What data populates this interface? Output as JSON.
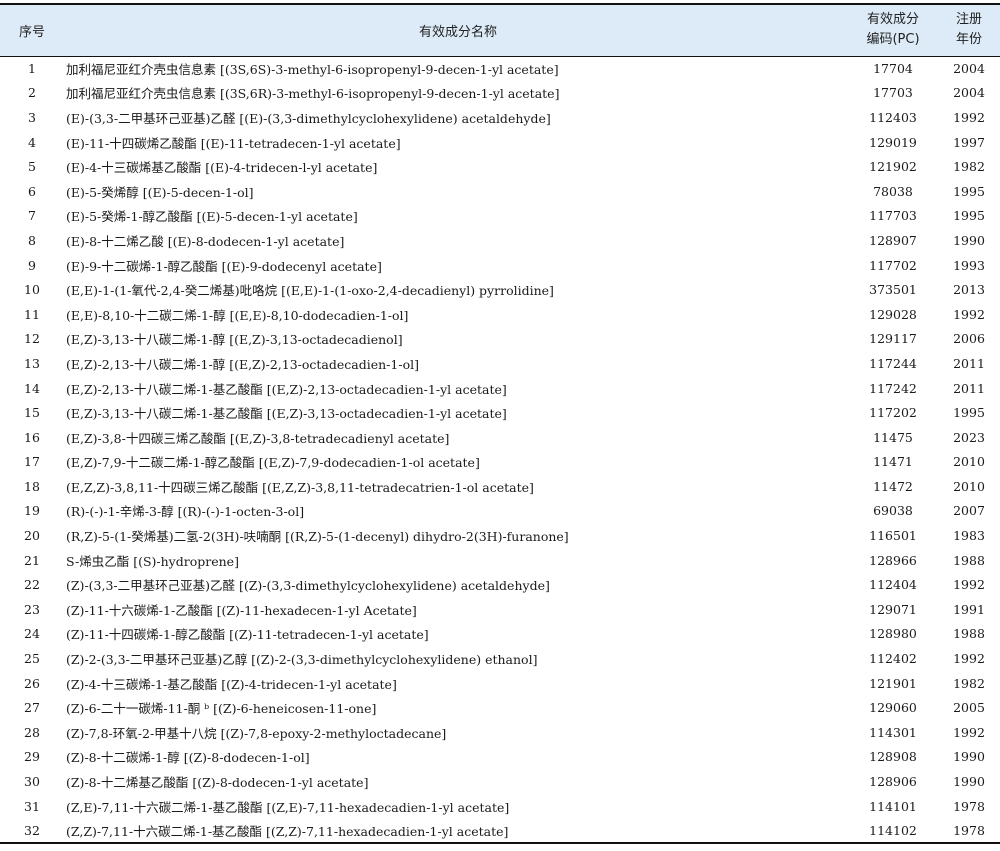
{
  "header": {
    "no": "序号",
    "name": "有效成分名称",
    "code_line1": "有效成分",
    "code_line2": "编码(PC)",
    "year_line1": "注册",
    "year_line2": "年份"
  },
  "rows": [
    {
      "no": "1",
      "name": "加利福尼亚红介壳虫信息素 [(3S,6S)-3-methyl-6-isopropenyl-9-decen-1-yl acetate]",
      "code": "17704",
      "year": "2004"
    },
    {
      "no": "2",
      "name": "加利福尼亚红介壳虫信息素 [(3S,6R)-3-methyl-6-isopropenyl-9-decen-1-yl acetate]",
      "code": "17703",
      "year": "2004"
    },
    {
      "no": "3",
      "name": "(E)-(3,3-二甲基环己亚基)乙醛 [(E)-(3,3-dimethylcyclohexylidene) acetaldehyde]",
      "code": "112403",
      "year": "1992"
    },
    {
      "no": "4",
      "name": "(E)-11-十四碳烯乙酸酯 [(E)-11-tetradecen-1-yl acetate]",
      "code": "129019",
      "year": "1997"
    },
    {
      "no": "5",
      "name": "(E)-4-十三碳烯基乙酸酯 [(E)-4-tridecen-l-yl acetate]",
      "code": "121902",
      "year": "1982"
    },
    {
      "no": "6",
      "name": "(E)-5-癸烯醇 [(E)-5-decen-1-ol]",
      "code": "78038",
      "year": "1995"
    },
    {
      "no": "7",
      "name": "(E)-5-癸烯-1-醇乙酸酯 [(E)-5-decen-1-yl acetate]",
      "code": "117703",
      "year": "1995"
    },
    {
      "no": "8",
      "name": "(E)-8-十二烯乙酸 [(E)-8-dodecen-1-yl acetate]",
      "code": "128907",
      "year": "1990"
    },
    {
      "no": "9",
      "name": "(E)-9-十二碳烯-1-醇乙酸酯 [(E)-9-dodecenyl acetate]",
      "code": "117702",
      "year": "1993"
    },
    {
      "no": "10",
      "name": "(E,E)-1-(1-氧代-2,4-癸二烯基)吡咯烷 [(E,E)-1-(1-oxo-2,4-decadienyl) pyrrolidine]",
      "code": "373501",
      "year": "2013"
    },
    {
      "no": "11",
      "name": "(E,E)-8,10-十二碳二烯-1-醇 [(E,E)-8,10-dodecadien-1-ol]",
      "code": "129028",
      "year": "1992"
    },
    {
      "no": "12",
      "name": "(E,Z)-3,13-十八碳二烯-1-醇 [(E,Z)-3,13-octadecadienol]",
      "code": "129117",
      "year": "2006"
    },
    {
      "no": "13",
      "name": "(E,Z)-2,13-十八碳二烯-1-醇 [(E,Z)-2,13-octadecadien-1-ol]",
      "code": "117244",
      "year": "2011"
    },
    {
      "no": "14",
      "name": "(E,Z)-2,13-十八碳二烯-1-基乙酸酯 [(E,Z)-2,13-octadecadien-1-yl acetate]",
      "code": "117242",
      "year": "2011"
    },
    {
      "no": "15",
      "name": "(E,Z)-3,13-十八碳二烯-1-基乙酸酯 [(E,Z)-3,13-octadecadien-1-yl acetate]",
      "code": "117202",
      "year": "1995"
    },
    {
      "no": "16",
      "name": "(E,Z)-3,8-十四碳三烯乙酸酯 [(E,Z)-3,8-tetradecadienyl acetate]",
      "code": "11475",
      "year": "2023"
    },
    {
      "no": "17",
      "name": "(E,Z)-7,9-十二碳二烯-1-醇乙酸酯 [(E,Z)-7,9-dodecadien-1-ol acetate]",
      "code": "11471",
      "year": "2010"
    },
    {
      "no": "18",
      "name": "(E,Z,Z)-3,8,11-十四碳三烯乙酸酯 [(E,Z,Z)-3,8,11-tetradecatrien-1-ol acetate]",
      "code": "11472",
      "year": "2010"
    },
    {
      "no": "19",
      "name": "(R)-(-)-1-辛烯-3-醇 [(R)-(-)-1-octen-3-ol]",
      "code": "69038",
      "year": "2007"
    },
    {
      "no": "20",
      "name": "(R,Z)-5-(1-癸烯基)二氢-2(3H)-呋喃酮 [(R,Z)-5-(1-decenyl) dihydro-2(3H)-furanone]",
      "code": "116501",
      "year": "1983"
    },
    {
      "no": "21",
      "name": "S-烯虫乙酯 [(S)-hydroprene]",
      "code": "128966",
      "year": "1988"
    },
    {
      "no": "22",
      "name": "(Z)-(3,3-二甲基环己亚基)乙醛 [(Z)-(3,3-dimethylcyclohexylidene) acetaldehyde]",
      "code": "112404",
      "year": "1992"
    },
    {
      "no": "23",
      "name": "(Z)-11-十六碳烯-1-乙酸酯 [(Z)-11-hexadecen-1-yl Acetate]",
      "code": "129071",
      "year": "1991"
    },
    {
      "no": "24",
      "name": "(Z)-11-十四碳烯-1-醇乙酸酯 [(Z)-11-tetradecen-1-yl acetate]",
      "code": "128980",
      "year": "1988"
    },
    {
      "no": "25",
      "name": "(Z)-2-(3,3-二甲基环己亚基)乙醇 [(Z)-2-(3,3-dimethylcyclohexylidene) ethanol]",
      "code": "112402",
      "year": "1992"
    },
    {
      "no": "26",
      "name": "(Z)-4-十三碳烯-1-基乙酸酯 [(Z)-4-tridecen-1-yl acetate]",
      "code": "121901",
      "year": "1982"
    },
    {
      "no": "27",
      "name": "(Z)-6-二十一碳烯-11-酮 ᵇ [(Z)-6-heneicosen-11-one]",
      "code": "129060",
      "year": "2005"
    },
    {
      "no": "28",
      "name": "(Z)-7,8-环氧-2-甲基十八烷 [(Z)-7,8-epoxy-2-methyloctadecane]",
      "code": "114301",
      "year": "1992"
    },
    {
      "no": "29",
      "name": "(Z)-8-十二碳烯-1-醇 [(Z)-8-dodecen-1-ol]",
      "code": "128908",
      "year": "1990"
    },
    {
      "no": "30",
      "name": "(Z)-8-十二烯基乙酸酯 [(Z)-8-dodecen-1-yl acetate]",
      "code": "128906",
      "year": "1990"
    },
    {
      "no": "31",
      "name": "(Z,E)-7,11-十六碳二烯-1-基乙酸酯 [(Z,E)-7,11-hexadecadien-1-yl acetate]",
      "code": "114101",
      "year": "1978"
    },
    {
      "no": "32",
      "name": "(Z,Z)-7,11-十六碳二烯-1-基乙酸酯 [(Z,Z)-7,11-hexadecadien-1-yl acetate]",
      "code": "114102",
      "year": "1978"
    }
  ]
}
